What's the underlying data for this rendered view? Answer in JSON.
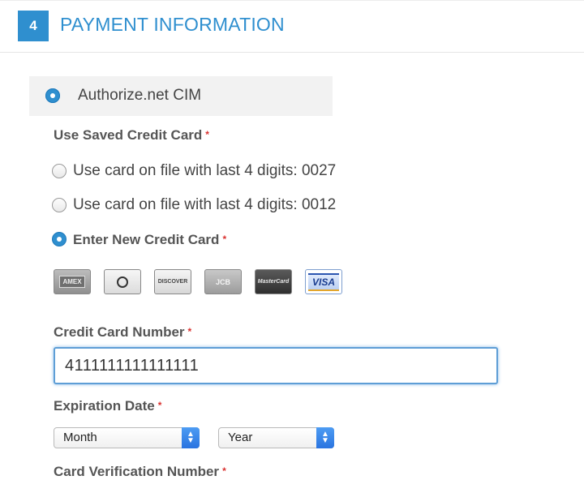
{
  "section": {
    "step_number": "4",
    "title": "PAYMENT INFORMATION"
  },
  "payment_method": {
    "label": "Authorize.net CIM",
    "selected": true
  },
  "saved_card": {
    "label": "Use Saved Credit Card",
    "required_mark": "*",
    "options": [
      {
        "label": "Use card on file with last 4 digits: 0027",
        "checked": false
      },
      {
        "label": "Use card on file with last 4 digits: 0012",
        "checked": false
      },
      {
        "label": "Enter New Credit Card",
        "checked": true,
        "required_mark": "*"
      }
    ]
  },
  "card_logos": [
    {
      "name": "amex-card-icon",
      "text": "AMEX"
    },
    {
      "name": "diners-card-icon",
      "text": ""
    },
    {
      "name": "discover-card-icon",
      "text": "DISCOVER"
    },
    {
      "name": "jcb-card-icon",
      "text": "JCB"
    },
    {
      "name": "mastercard-card-icon",
      "text": "MasterCard"
    },
    {
      "name": "visa-card-icon",
      "text": "VISA"
    }
  ],
  "card_number": {
    "label": "Credit Card Number",
    "required_mark": "*",
    "value": "4111111111111111"
  },
  "expiration": {
    "label": "Expiration Date",
    "required_mark": "*",
    "month_value": "Month",
    "year_value": "Year"
  },
  "cvv": {
    "label": "Card Verification Number",
    "required_mark": "*"
  },
  "colors": {
    "accent": "#2f8fcf",
    "required": "#d9312f"
  }
}
